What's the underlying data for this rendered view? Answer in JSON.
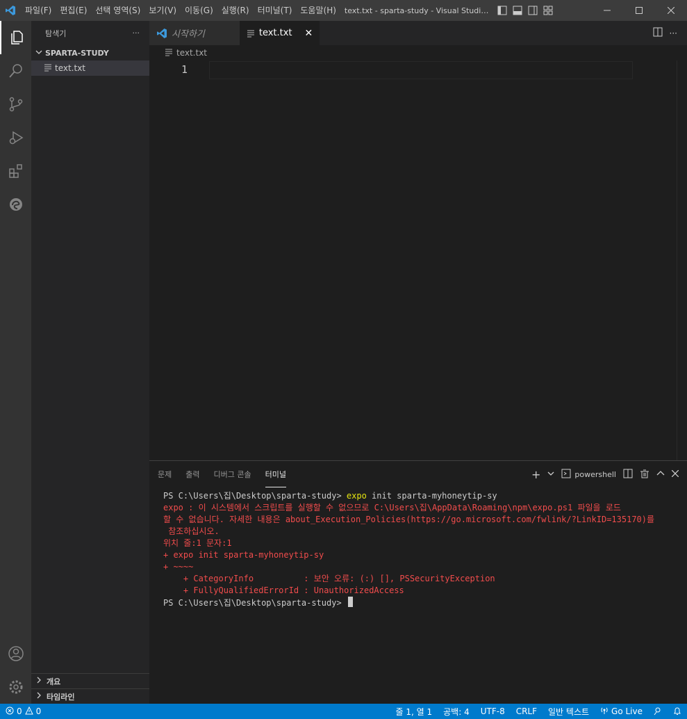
{
  "menu": [
    "파일(F)",
    "편집(E)",
    "선택 영역(S)",
    "보기(V)",
    "이동(G)",
    "실행(R)",
    "터미널(T)",
    "도움말(H)"
  ],
  "window_title": "text.txt - sparta-study - Visual Studio ...",
  "sidebar": {
    "title": "탐색기",
    "folder": "SPARTA-STUDY",
    "file": "text.txt",
    "outline": "개요",
    "timeline": "타임라인"
  },
  "tabs": [
    {
      "label": "시작하기",
      "active": false
    },
    {
      "label": "text.txt",
      "active": true
    }
  ],
  "breadcrumb": "text.txt",
  "editor": {
    "line_number": "1"
  },
  "panel": {
    "tabs": [
      "문제",
      "출력",
      "디버그 콘솔",
      "터미널"
    ],
    "active_tab": "터미널",
    "shell": "powershell"
  },
  "terminal": {
    "prompt1": "PS C:\\Users\\집\\Desktop\\sparta-study> ",
    "cmd_keyword": "expo",
    "cmd_rest": " init sparta-myhoneytip-sy",
    "err1": "expo : 이 시스템에서 스크립트를 실행할 수 없으므로 C:\\Users\\집\\AppData\\Roaming\\npm\\expo.ps1 파일을 로드",
    "err2": "할 수 없습니다. 자세한 내용은 about_Execution_Policies(https://go.microsoft.com/fwlink/?LinkID=135170)를",
    "err3": " 참조하십시오.",
    "err4": "위치 줄:1 문자:1",
    "err5": "+ expo init sparta-myhoneytip-sy",
    "err6": "+ ~~~~",
    "err7": "    + CategoryInfo          : 보안 오류: (:) [], PSSecurityException",
    "err8": "    + FullyQualifiedErrorId : UnauthorizedAccess",
    "prompt2": "PS C:\\Users\\집\\Desktop\\sparta-study> "
  },
  "status": {
    "errors": "0",
    "warnings": "0",
    "position": "줄 1, 열 1",
    "spaces": "공백: 4",
    "encoding": "UTF-8",
    "eol": "CRLF",
    "language": "일반 텍스트",
    "golive": "Go Live"
  },
  "colors": {
    "accent": "#007acc",
    "error": "#f14c4c",
    "keyword": "#e5e510"
  }
}
